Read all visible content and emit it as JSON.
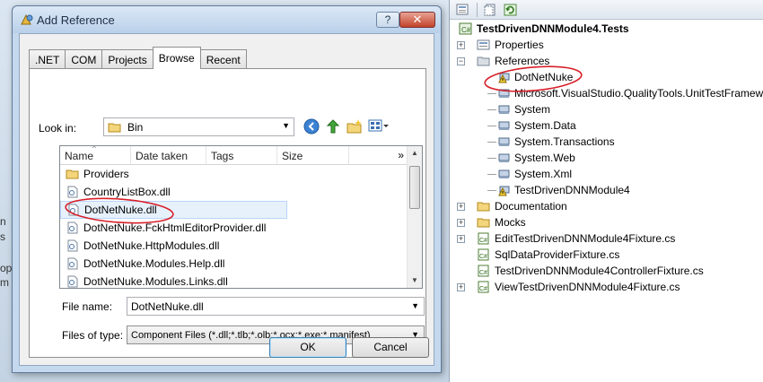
{
  "dialog": {
    "title": "Add Reference",
    "help_label": "?",
    "close_label": "✕",
    "tabs": [
      {
        "label": ".NET"
      },
      {
        "label": "COM"
      },
      {
        "label": "Projects"
      },
      {
        "label": "Browse"
      },
      {
        "label": "Recent"
      }
    ],
    "active_tab": "Browse",
    "look_in_label": "Look in:",
    "look_in_value": "Bin",
    "columns": [
      "Name",
      "Date taken",
      "Tags",
      "Size"
    ],
    "more_columns": "»",
    "files": [
      {
        "name": "Providers",
        "type": "folder"
      },
      {
        "name": "CountryListBox.dll",
        "type": "dll"
      },
      {
        "name": "DotNetNuke.dll",
        "type": "dll",
        "selected": true
      },
      {
        "name": "DotNetNuke.FckHtmlEditorProvider.dll",
        "type": "dll"
      },
      {
        "name": "DotNetNuke.HttpModules.dll",
        "type": "dll"
      },
      {
        "name": "DotNetNuke.Modules.Help.dll",
        "type": "dll"
      },
      {
        "name": "DotNetNuke.Modules.Links.dll",
        "type": "dll"
      }
    ],
    "file_name_label": "File name:",
    "file_name_value": "DotNetNuke.dll",
    "files_of_type_label": "Files of type:",
    "files_of_type_value": "Component Files (*.dll;*.tlb;*.olb;*.ocx;*.exe;*.manifest)",
    "ok_label": "OK",
    "cancel_label": "Cancel"
  },
  "solution_explorer": {
    "project": "TestDrivenDNNModule4.Tests",
    "items": {
      "properties": "Properties",
      "references": "References",
      "refs": [
        "DotNetNuke",
        "Microsoft.VisualStudio.QualityTools.UnitTestFramework",
        "System",
        "System.Data",
        "System.Transactions",
        "System.Web",
        "System.Xml",
        "TestDrivenDNNModule4"
      ],
      "documentation": "Documentation",
      "mocks": "Mocks",
      "files": [
        "EditTestDrivenDNNModule4Fixture.cs",
        "SqlDataProviderFixture.cs",
        "TestDrivenDNNModule4ControllerFixture.cs",
        "ViewTestDrivenDNNModule4Fixture.cs"
      ]
    }
  },
  "background_clipped_text": [
    "n",
    "s",
    "op",
    "m"
  ],
  "colors": {
    "annotation_red": "#d8202a",
    "dialog_frame": "#c4d8ee",
    "selection": "#e7f1fc"
  }
}
